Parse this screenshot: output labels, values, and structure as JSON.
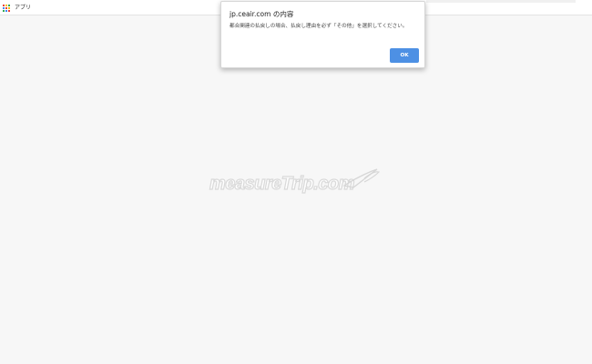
{
  "bookmarks_bar": {
    "apps_label": "アプリ",
    "apps_icon": "apps-grid-icon",
    "apps_icon_colors": [
      "#ea4335",
      "#fbbc05",
      "#34a853",
      "#4285f4",
      "#ea4335",
      "#fbbc05",
      "#34a853",
      "#4285f4",
      "#ea4335"
    ]
  },
  "dialog": {
    "title": "jp.ceair.com の内容",
    "message": "都合関連の払戻しの場合、払戻し理由を必ず「その他」を選択してください。",
    "ok_label": "OK",
    "accent_color": "#4d90e4"
  },
  "watermark": {
    "text": "measureTrip.com"
  }
}
